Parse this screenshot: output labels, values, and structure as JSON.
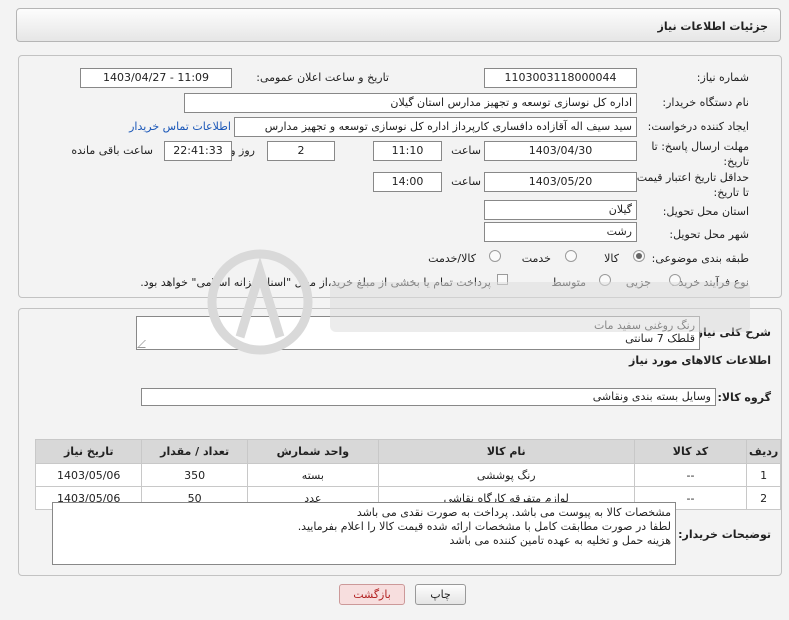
{
  "page_title": "جزئیات اطلاعات نیاز",
  "labels": {
    "need_number": "شماره نیاز:",
    "announce_datetime": "تاریخ و ساعت اعلان عمومی:",
    "buyer_name": "نام دستگاه خریدار:",
    "requester": "ایجاد کننده درخواست:",
    "deadline_reply": "مهلت ارسال پاسخ: تا تاریخ:",
    "time_word": "ساعت",
    "day_and": "روز و",
    "remaining_hours": "ساعت باقی مانده",
    "price_validity": "حداقل تاریخ اعتبار قیمت: تا تاریخ:",
    "province": "استان محل تحویل:",
    "city": "شهر محل تحویل:",
    "category": "طبقه بندی موضوعی:",
    "purchase_type": "نوع فرآیند خرید :",
    "general_desc": "شرح کلی نیاز:",
    "goods_info": "اطلاعات کالاهای مورد نیاز",
    "goods_group": "گروه کالا:",
    "buyer_notes": "توضیحات خریدار:"
  },
  "values": {
    "need_number": "1103003118000044",
    "announce_datetime": "1403/04/27 - 11:09",
    "buyer_name": "اداره کل نوسازی  توسعه و تجهیز مدارس استان گیلان",
    "requester": "سید سیف اله آقازاده دافساری کارپرداز اداره کل نوسازی  توسعه و تجهیز مدارس",
    "contact_link": "اطلاعات تماس خریدار",
    "deadline_date": "1403/04/30",
    "deadline_time": "11:10",
    "remaining_days": "2",
    "remaining_time": "22:41:33",
    "validity_date": "1403/05/20",
    "validity_time": "14:00",
    "province": "گیلان",
    "city": "رشت",
    "general_desc": "رنگ روغنی سفید مات\nقلطک 7 سانتی",
    "goods_group": "وسایل بسته بندی  ونقاشی",
    "buyer_notes": "مشخصات کالا به پیوست می باشد. پرداخت به صورت نقدی می باشد\nلطفا در صورت مطابقت کامل با مشخصات ارائه شده قیمت کالا را اعلام بفرمایید.\nهزینه حمل و تخلیه به عهده تامین کننده می باشد"
  },
  "category_options": [
    {
      "label": "کالا",
      "selected": true
    },
    {
      "label": "خدمت",
      "selected": false
    },
    {
      "label": "کالا/خدمت",
      "selected": false
    }
  ],
  "purchase_options": [
    {
      "label": "جزیی",
      "selected": false
    },
    {
      "label": "متوسط",
      "selected": false
    }
  ],
  "payment_checkbox_label": "پرداخت تمام یا بخشی از مبلغ خرید،از محل \"اسناد خزانه اسلامی\" خواهد بود.",
  "table": {
    "headers": [
      "ردیف",
      "کد کالا",
      "نام کالا",
      "واحد شمارش",
      "تعداد / مقدار",
      "تاریخ نیاز"
    ],
    "rows": [
      [
        "1",
        "--",
        "رنگ پوششی",
        "بسته",
        "350",
        "1403/05/06"
      ],
      [
        "2",
        "--",
        "لوازم متفرقه کارگاه نقاشی",
        "عدد",
        "50",
        "1403/05/06"
      ]
    ]
  },
  "buttons": {
    "print": "چاپ",
    "back": "بازگشت"
  },
  "colors": {
    "link": "#1a57b8",
    "back_button_bg": "#f7dede",
    "back_button_text": "#b22222"
  }
}
